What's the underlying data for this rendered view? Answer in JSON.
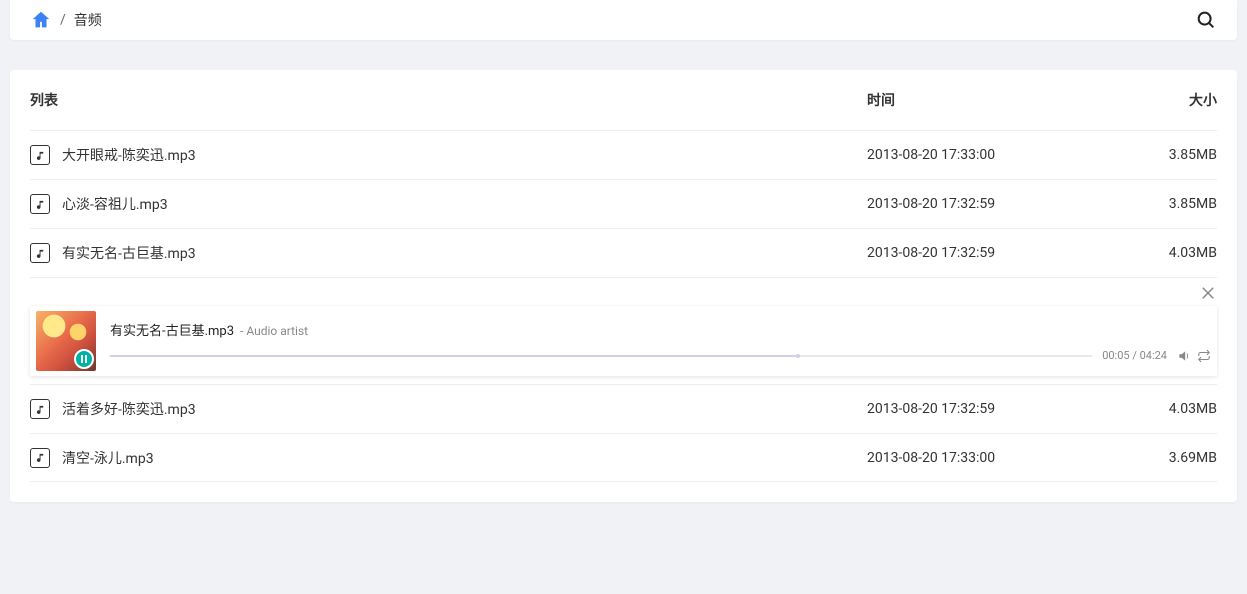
{
  "breadcrumb": {
    "sep": "/",
    "current": "音频"
  },
  "header": {
    "name": "列表",
    "time": "时间",
    "size": "大小"
  },
  "rows": [
    {
      "name": "大开眼戒-陈奕迅.mp3",
      "time": "2013-08-20 17:33:00",
      "size": "3.85MB"
    },
    {
      "name": "心淡-容祖儿.mp3",
      "time": "2013-08-20 17:32:59",
      "size": "3.85MB"
    },
    {
      "name": "有实无名-古巨基.mp3",
      "time": "2013-08-20 17:32:59",
      "size": "4.03MB"
    },
    {
      "name": "活着多好-陈奕迅.mp3",
      "time": "2013-08-20 17:32:59",
      "size": "4.03MB"
    },
    {
      "name": "清空-泳儿.mp3",
      "time": "2013-08-20 17:33:00",
      "size": "3.69MB"
    }
  ],
  "player": {
    "title": "有实无名-古巨基.mp3",
    "artist_sep": " - ",
    "artist": "Audio artist",
    "current": "00:05",
    "total": "04:24",
    "time_sep": " / ",
    "progress_pct": 70
  }
}
